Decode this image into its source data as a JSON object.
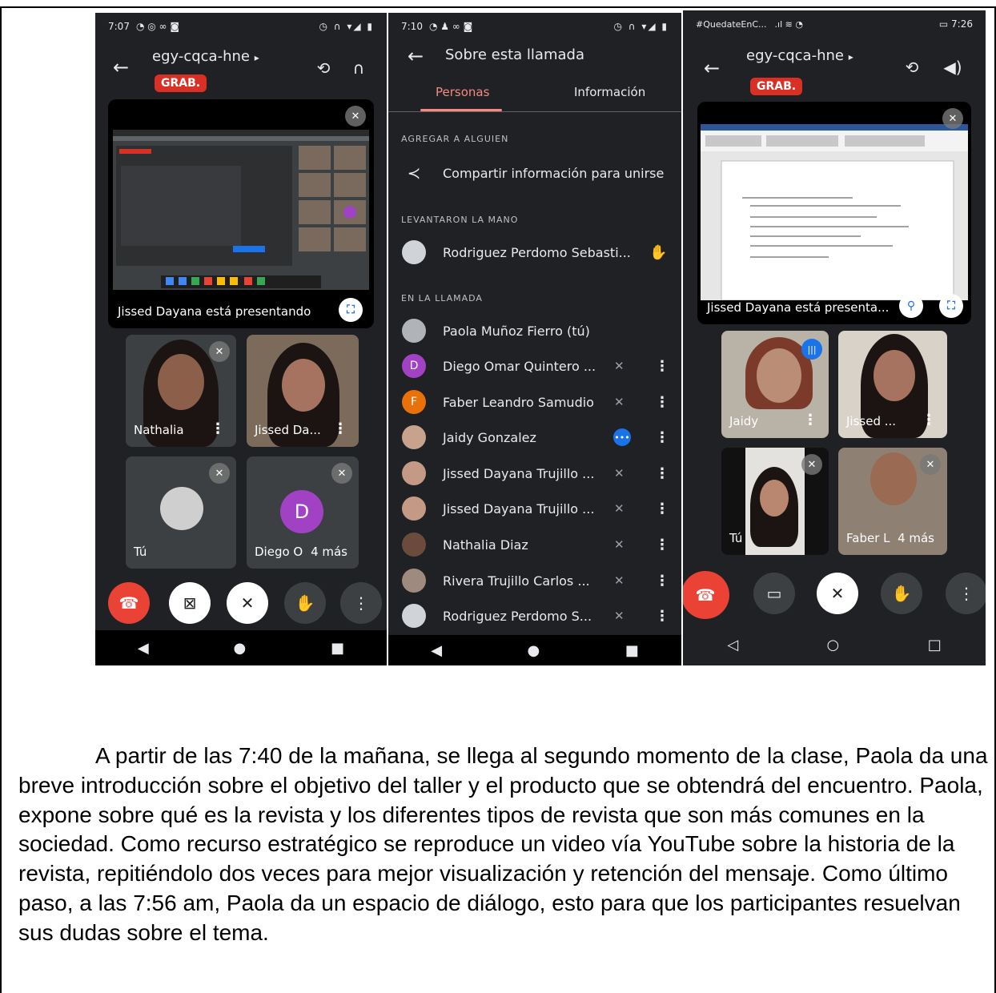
{
  "panel1": {
    "status_time": "7:07",
    "meet_code": "egy-cqca-hne",
    "rec_badge": "GRAB.",
    "presenting_label": "Jissed Dayana está presentando",
    "tiles": [
      {
        "name": "Nathalia"
      },
      {
        "name": "Jissed Da..."
      },
      {
        "name": "Tú"
      },
      {
        "name": "Diego O",
        "avatar_letter": "D",
        "more": "4 más"
      }
    ]
  },
  "panel2": {
    "status_time": "7:10",
    "title": "Sobre esta llamada",
    "tabs": [
      "Personas",
      "Información"
    ],
    "add_section": "AGREGAR A ALGUIEN",
    "share_label": "Compartir información para unirse",
    "raised_section": "LEVANTARON LA MANO",
    "raised_person": "Rodriguez Perdomo Sebasti...",
    "call_section": "EN LA LLAMADA",
    "participants": [
      {
        "name": "Paola Muñoz Fierro (tú)",
        "avatar": ""
      },
      {
        "name": "Diego Omar Quintero ...",
        "avatar": "D"
      },
      {
        "name": "Faber Leandro Samudio",
        "avatar": "F"
      },
      {
        "name": "Jaidy Gonzalez",
        "avatar": ""
      },
      {
        "name": "Jissed Dayana Trujillo ...",
        "avatar": ""
      },
      {
        "name": "Jissed Dayana Trujillo ...",
        "avatar": ""
      },
      {
        "name": "Nathalia Diaz",
        "avatar": ""
      },
      {
        "name": "Rivera Trujillo Carlos ...",
        "avatar": ""
      },
      {
        "name": "Rodriguez Perdomo S...",
        "avatar": ""
      }
    ]
  },
  "panel3": {
    "status_left": "#QuedateEnC...",
    "status_time": "7:26",
    "meet_code": "egy-cqca-hne",
    "rec_badge": "GRAB.",
    "presenting_label": "Jissed Dayana está presenta...",
    "tiles": [
      {
        "name": "Jaidy"
      },
      {
        "name": "Jissed ..."
      },
      {
        "name": "Tú"
      },
      {
        "name": "Faber L",
        "more": "4 más"
      }
    ]
  },
  "narrative": "A partir de las 7:40 de la mañana, se llega al segundo momento de la clase, Paola da una breve introducción sobre el objetivo del taller y el producto que se obtendrá del encuentro. Paola, expone sobre qué es la revista y los diferentes tipos de revista que son más comunes en la sociedad. Como recurso estratégico se reproduce un video vía YouTube sobre la historia de la revista, repitiéndolo dos veces para mejor visualización y retención del mensaje. Como último paso, a las 7:56 am, Paola da un espacio de diálogo, esto para que los participantes resuelvan sus dudas sobre el tema.",
  "colors": {
    "meet_dark": "#202124",
    "rec_red": "#d93025",
    "hangup_red": "#ea4335",
    "tab_accent": "#f28b82",
    "avatar_purple": "#a142c4",
    "avatar_orange": "#e8710a",
    "speaking_blue": "#1a73e8"
  }
}
